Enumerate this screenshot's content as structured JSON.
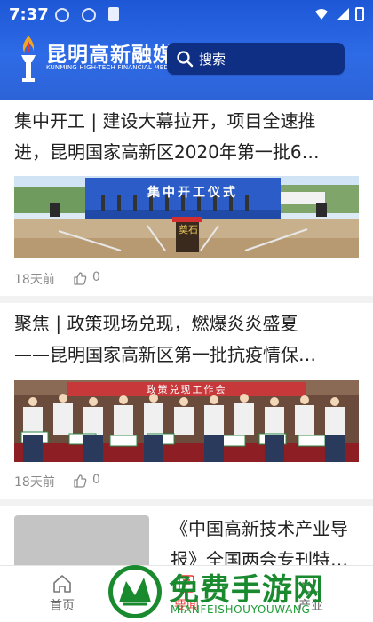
{
  "status": {
    "time": "7:37"
  },
  "brand": {
    "name": "昆明高新融媒",
    "subtitle": "KUNMING HIGH-TECH FINANCIAL MEDIA"
  },
  "search": {
    "placeholder": "搜索"
  },
  "articles": [
    {
      "title_line1": "集中开工 | 建设大幕拉开，项目全速推",
      "title_line2": "进，昆明国家高新区2020年第一批6…",
      "image_banner": "集中开工仪式",
      "image_stone": "奠石",
      "time": "18天前",
      "likes": "0"
    },
    {
      "title_line1": "聚焦 | 政策现场兑现，燃爆炎炎盛夏",
      "title_line2": "——昆明国家高新区第一批抗疫情保…",
      "image_banner": "政策兑现工作会",
      "time": "18天前",
      "likes": "0"
    },
    {
      "title_line1": "《中国高新技术产业导",
      "title_line2": "报》全国两会专刊特…"
    }
  ],
  "nav": [
    {
      "label": "首页",
      "icon": "home-icon"
    },
    {
      "label": "要闻",
      "icon": "news-icon"
    },
    {
      "label": "产业",
      "icon": "industry-icon"
    }
  ],
  "watermark": {
    "text": "免费手游网",
    "sub": "MIANFEISHOUYOUWANG"
  },
  "colors": {
    "header": "#2e6be6",
    "search_bg": "#0f2f84",
    "active": "#e33",
    "watermark": "#1a8a2f"
  }
}
